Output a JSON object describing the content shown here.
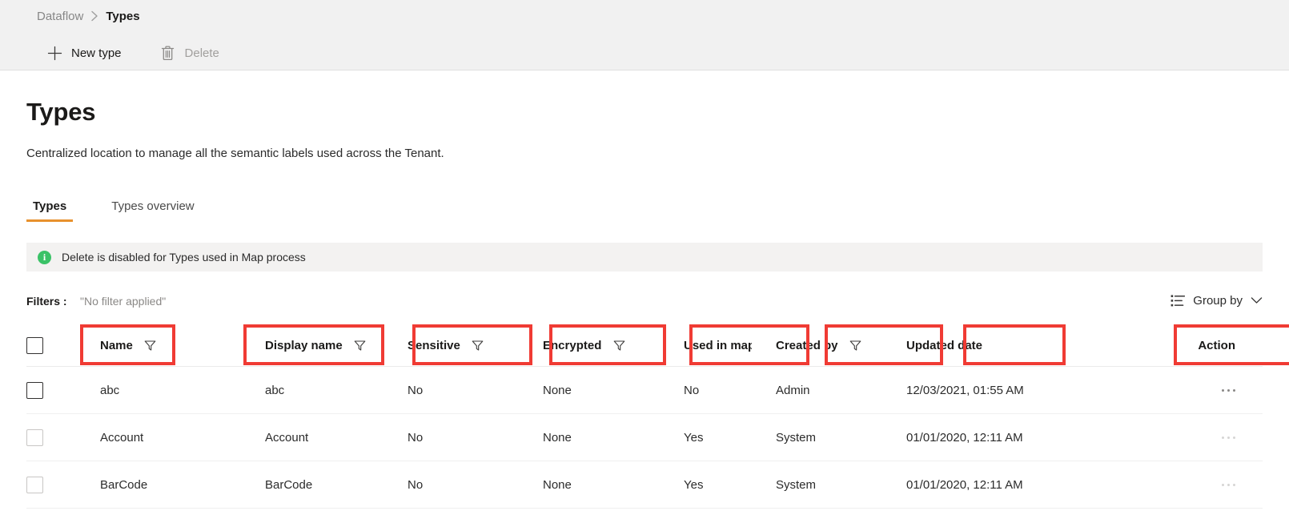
{
  "breadcrumb": {
    "root": "Dataflow",
    "separator_icon": "chevron-right-icon",
    "current": "Types"
  },
  "toolbar": {
    "new_type_label": "New type",
    "new_type_icon": "plus-icon",
    "delete_label": "Delete",
    "delete_icon": "trash-icon",
    "delete_disabled": true
  },
  "page": {
    "title": "Types",
    "subtitle": "Centralized location to manage all the semantic labels used across the Tenant."
  },
  "tabs": [
    {
      "label": "Types",
      "active": true
    },
    {
      "label": "Types overview",
      "active": false
    }
  ],
  "info_banner": {
    "icon": "info-icon",
    "icon_glyph": "i",
    "text": "Delete is disabled for Types used in Map process",
    "icon_color": "#3ac267",
    "background": "#f3f2f1"
  },
  "filter_bar": {
    "label": "Filters :",
    "value": "\"No filter applied\"",
    "group_by_label": "Group by",
    "group_by_icon": "list-group-icon",
    "group_by_chevron": "chevron-down-icon"
  },
  "table": {
    "select_all_checkbox": "",
    "columns": [
      {
        "label": "Name",
        "filterable": true,
        "annotated": true
      },
      {
        "label": "Display name",
        "filterable": true,
        "annotated": true
      },
      {
        "label": "Sensitive",
        "filterable": true,
        "annotated": true
      },
      {
        "label": "Encrypted",
        "filterable": true,
        "annotated": true
      },
      {
        "label": "Used in map",
        "filterable": true,
        "annotated": true
      },
      {
        "label": "Created by",
        "filterable": true,
        "annotated": true
      },
      {
        "label": "Updated date",
        "filterable": false,
        "annotated": true
      },
      {
        "label": "Action",
        "filterable": false,
        "annotated": true
      }
    ],
    "rows": [
      {
        "name": "abc",
        "display_name": "abc",
        "sensitive": "No",
        "encrypted": "None",
        "used_in_map": "No",
        "created_by": "Admin",
        "updated_date": "12/03/2021, 01:55 AM",
        "action_icon": "ellipsis-icon",
        "hovered": true
      },
      {
        "name": "Account",
        "display_name": "Account",
        "sensitive": "No",
        "encrypted": "None",
        "used_in_map": "Yes",
        "created_by": "System",
        "updated_date": "01/01/2020, 12:11 AM",
        "action_icon": "ellipsis-icon",
        "hovered": false
      },
      {
        "name": "BarCode",
        "display_name": "BarCode",
        "sensitive": "No",
        "encrypted": "None",
        "used_in_map": "Yes",
        "created_by": "System",
        "updated_date": "01/01/2020, 12:11 AM",
        "action_icon": "ellipsis-icon",
        "hovered": false
      }
    ]
  },
  "colors": {
    "accent_tab_underline": "#e8912d",
    "annotation_box": "#f03b34",
    "chrome_background": "#f1f1f1",
    "banner_background": "#f3f2f1",
    "info_green": "#3ac267"
  }
}
